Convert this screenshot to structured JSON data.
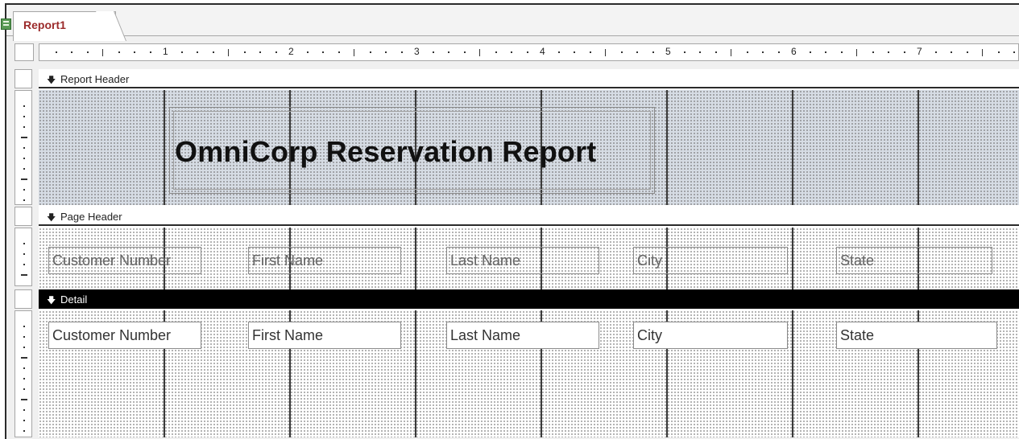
{
  "tab": {
    "label": "Report1",
    "icon": "report-icon"
  },
  "ruler": {
    "numbers": [
      "1",
      "2",
      "3",
      "4",
      "5",
      "6",
      "7"
    ]
  },
  "sections": {
    "report_header": {
      "label": "Report Header"
    },
    "page_header": {
      "label": "Page Header"
    },
    "detail": {
      "label": "Detail"
    }
  },
  "report_title": "OmniCorp Reservation Report",
  "page_header_labels": [
    "Customer Number",
    "First Name",
    "Last Name",
    "City",
    "State"
  ],
  "detail_fields": [
    "Customer Number",
    "First Name",
    "Last Name",
    "City",
    "State"
  ],
  "colors": {
    "tab_text": "#9b2a2a",
    "header_shading": "#d6dce4",
    "detail_bar": "#000000"
  }
}
